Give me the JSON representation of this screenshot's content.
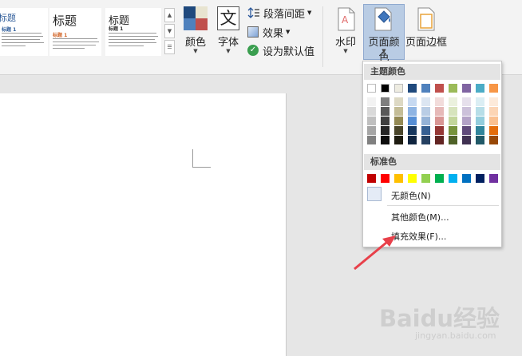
{
  "gallery": {
    "items": [
      {
        "heading": "标题",
        "subheading": "标题 1"
      },
      {
        "heading": "标题",
        "subheading": "标题 1"
      },
      {
        "heading": "标题",
        "subheading": "标题 1"
      }
    ]
  },
  "ribbon": {
    "colors_label": "颜色",
    "fonts_label": "字体",
    "fonts_glyph": "文",
    "paragraph_spacing_label": "段落间距",
    "effects_label": "效果",
    "set_default_label": "设为默认值",
    "watermark_label": "水印",
    "page_color_label": "页面颜色",
    "page_borders_label": "页面边框"
  },
  "dropdown": {
    "theme_colors_header": "主题颜色",
    "standard_colors_header": "标准色",
    "no_color_label": "无颜色(N)",
    "more_colors_label": "其他颜色(M)...",
    "fill_effects_label": "填充效果(F)...",
    "theme_colors": [
      [
        "#ffffff",
        "#f2f2f2",
        "#d9d9d9",
        "#bfbfbf",
        "#a6a6a6",
        "#808080"
      ],
      [
        "#000000",
        "#7f7f7f",
        "#595959",
        "#404040",
        "#262626",
        "#0d0d0d"
      ],
      [
        "#eeece1",
        "#ddd9c4",
        "#c4bd97",
        "#948a54",
        "#4a452a",
        "#1e1c11"
      ],
      [
        "#1f497d",
        "#c6d9f1",
        "#8eb4e3",
        "#558ed5",
        "#17375e",
        "#10243f"
      ],
      [
        "#4f81bd",
        "#dce6f2",
        "#b9cde5",
        "#95b3d7",
        "#376092",
        "#254061"
      ],
      [
        "#c0504d",
        "#f2dcdb",
        "#e6b9b8",
        "#d99694",
        "#953735",
        "#632523"
      ],
      [
        "#9bbb59",
        "#ebf1de",
        "#d7e4bd",
        "#c3d69b",
        "#77933c",
        "#4f6228"
      ],
      [
        "#8064a2",
        "#e6e0ec",
        "#ccc1da",
        "#b3a2c7",
        "#604a7b",
        "#403152"
      ],
      [
        "#4bacc6",
        "#dbeef4",
        "#b7dee8",
        "#93cddd",
        "#31859c",
        "#215968"
      ],
      [
        "#f79646",
        "#fdeada",
        "#fcd5b5",
        "#fac090",
        "#e46c0a",
        "#984807"
      ]
    ],
    "standard_colors": [
      "#c00000",
      "#ff0000",
      "#ffc000",
      "#ffff00",
      "#92d050",
      "#00b050",
      "#00b0f0",
      "#0070c0",
      "#002060",
      "#7030a0"
    ]
  },
  "watermark": {
    "brand": "Baidu经验",
    "url": "jingyan.baidu.com"
  }
}
